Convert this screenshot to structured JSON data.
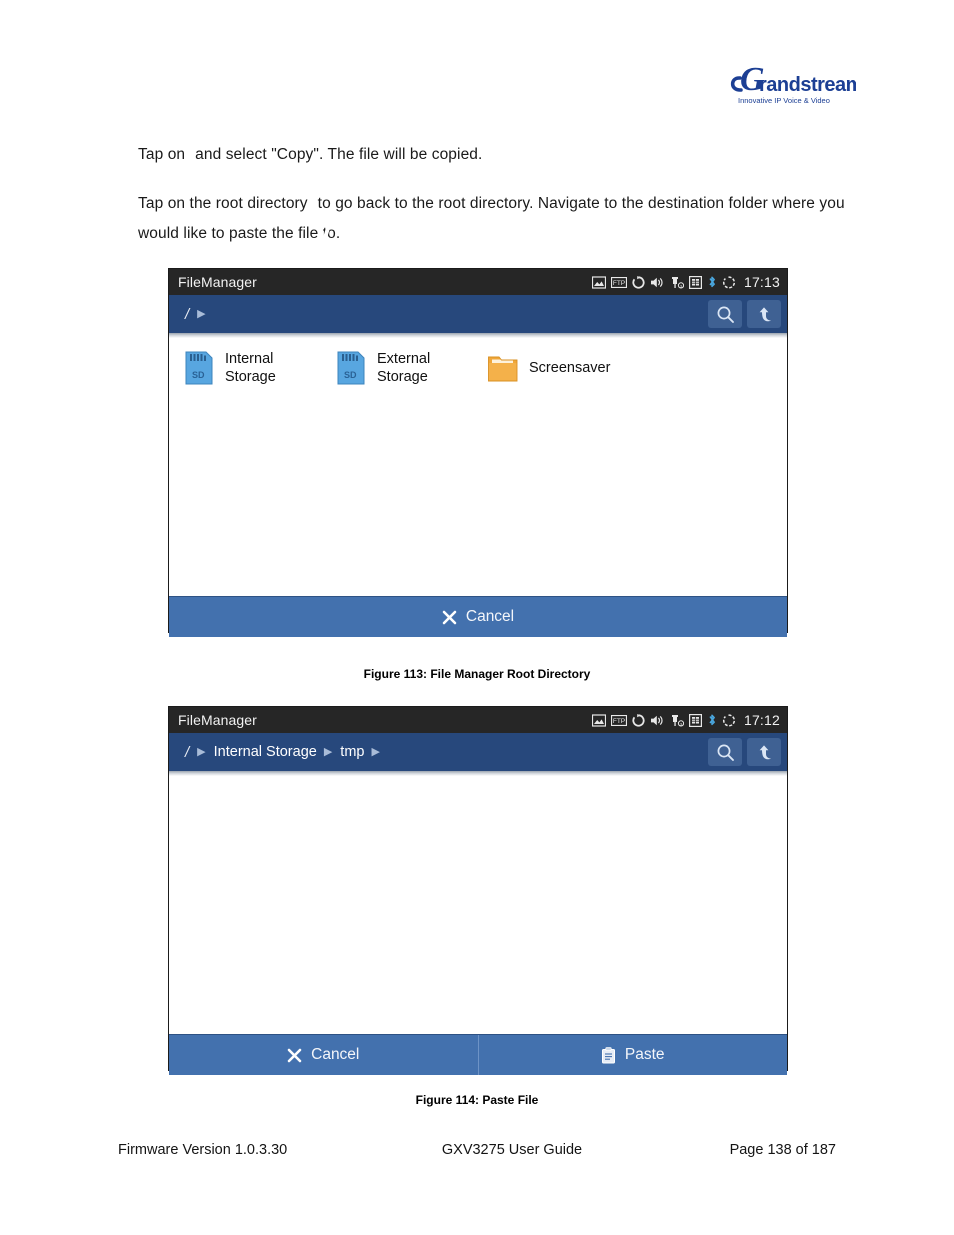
{
  "brand": {
    "name": "Grandstream",
    "tagline": "Innovative IP Voice & Video"
  },
  "body": {
    "paragraph_1_part_1": "Tap on",
    "paragraph_1_icon": "menu-icon",
    "paragraph_1_part_2": "and select \"Copy\". The file will be copied.",
    "paragraph_2_part_1": "Tap on the root directory",
    "paragraph_2_icon": "root-directory-icon",
    "paragraph_2_part_2": "to go back to the root directory. Navigate to the destination folder where you would like to paste the file to."
  },
  "figure_113": {
    "caption": "Figure 113: File Manager Root Directory",
    "statusbar": {
      "app_title": "FileManager",
      "clock": "17:13",
      "icons": [
        "image-icon",
        "ftp-icon",
        "sync-icon",
        "volume-icon",
        "charging-icon",
        "sim-card-icon",
        "bluetooth-icon",
        "rotate-icon"
      ]
    },
    "breadcrumb": {
      "root": "/",
      "items": [],
      "search_label": "search-icon",
      "up_label": "up-directory-icon"
    },
    "files": [
      {
        "name": "Internal Storage",
        "icon": "sd-card-icon"
      },
      {
        "name": "External Storage",
        "icon": "sd-card-icon"
      },
      {
        "name": "Screensaver",
        "icon": "folder-icon"
      }
    ],
    "actions": [
      {
        "label": "Cancel",
        "icon": "close-icon"
      }
    ]
  },
  "figure_114": {
    "caption": "Figure 114: Paste File",
    "statusbar": {
      "app_title": "FileManager",
      "clock": "17:12",
      "icons": [
        "image-icon",
        "ftp-icon",
        "sync-icon",
        "volume-icon",
        "charging-icon",
        "sim-card-icon",
        "bluetooth-icon",
        "rotate-icon"
      ]
    },
    "breadcrumb": {
      "root": "/",
      "items": [
        "Internal Storage",
        "tmp"
      ],
      "search_label": "search-icon",
      "up_label": "up-directory-icon"
    },
    "files": [],
    "actions": [
      {
        "label": "Cancel",
        "icon": "close-icon"
      },
      {
        "label": "Paste",
        "icon": "clipboard-icon"
      }
    ]
  },
  "footer": {
    "firmware": "Firmware Version 1.0.3.30",
    "guide": "GXV3275 User Guide",
    "page": "Page 138 of 187"
  },
  "colors": {
    "statusbar_bg": "#262626",
    "breadcrumb_bg": "#27487c",
    "action_bg": "#4371ae",
    "accent_blue": "#4a90d9",
    "folder_orange": "#f0a73a",
    "sd_blue": "#52a0dc"
  }
}
